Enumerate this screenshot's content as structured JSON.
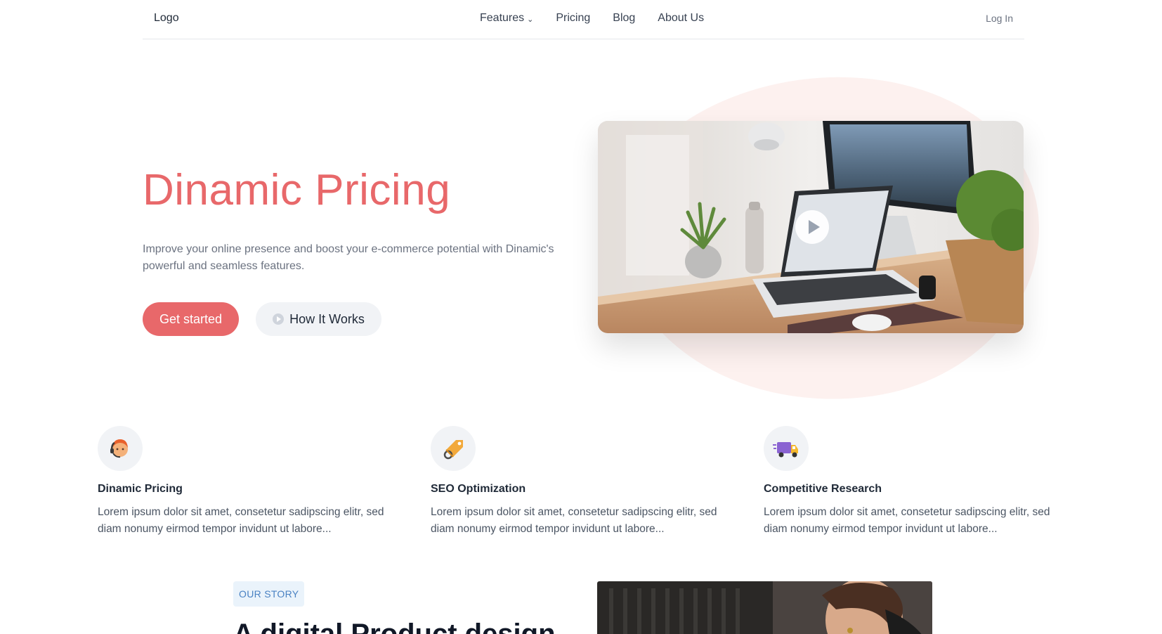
{
  "nav": {
    "logo": "Logo",
    "items": [
      {
        "label": "Features",
        "has_dropdown": true
      },
      {
        "label": "Pricing"
      },
      {
        "label": "Blog"
      },
      {
        "label": "About Us"
      }
    ],
    "login": "Log In"
  },
  "hero": {
    "title": "Dinamic Pricing",
    "subtitle": "Improve your online presence and boost your e-commerce potential with Dinamic's powerful and seamless features.",
    "cta_primary": "Get started",
    "cta_secondary": "How It Works",
    "video_icon": "play-icon"
  },
  "features": [
    {
      "icon": "support-agent-icon",
      "title": "Dinamic Pricing",
      "text": "Lorem ipsum dolor sit amet, consetetur sadipscing elitr, sed diam nonumy eirmod tempor invidunt ut labore..."
    },
    {
      "icon": "price-tag-icon",
      "title": "SEO Optimization",
      "text": "Lorem ipsum dolor sit amet, consetetur sadipscing elitr, sed diam nonumy eirmod tempor invidunt ut labore..."
    },
    {
      "icon": "delivery-truck-icon",
      "title": "Competitive Research",
      "text": "Lorem ipsum dolor sit amet, consetetur sadipscing elitr, sed diam nonumy eirmod tempor invidunt ut labore..."
    }
  ],
  "story": {
    "badge": "OUR STORY",
    "heading": "A digital Product design"
  },
  "colors": {
    "accent": "#e8686a",
    "badge_text": "#4a82c3",
    "badge_bg": "#eaf3fb",
    "blob": "#fdf1ef"
  }
}
